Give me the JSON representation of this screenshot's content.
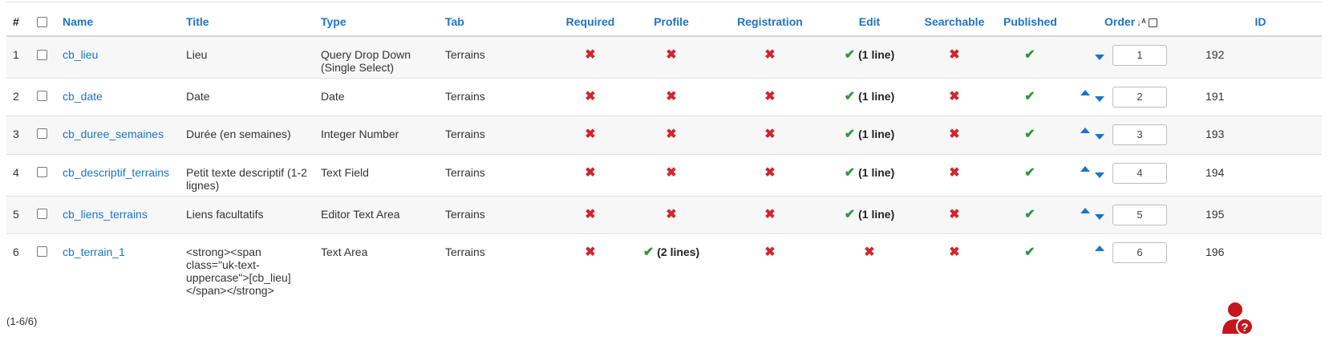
{
  "columns": {
    "num": "#",
    "name": "Name",
    "title": "Title",
    "type": "Type",
    "tab": "Tab",
    "required": "Required",
    "profile": "Profile",
    "registration": "Registration",
    "edit": "Edit",
    "searchable": "Searchable",
    "published": "Published",
    "order": "Order",
    "id": "ID"
  },
  "rows": [
    {
      "num": "1",
      "name": "cb_lieu",
      "title": "Lieu",
      "type": "Query Drop Down (Single Select)",
      "tab": "Terrains",
      "required": "no",
      "profile": "no",
      "profile_note": "",
      "registration": "no",
      "edit": "yes",
      "edit_note": "(1 line)",
      "searchable": "no",
      "published": "yes",
      "order": "1",
      "id": "192"
    },
    {
      "num": "2",
      "name": "cb_date",
      "title": "Date",
      "type": "Date",
      "tab": "Terrains",
      "required": "no",
      "profile": "no",
      "profile_note": "",
      "registration": "no",
      "edit": "yes",
      "edit_note": "(1 line)",
      "searchable": "no",
      "published": "yes",
      "order": "2",
      "id": "191"
    },
    {
      "num": "3",
      "name": "cb_duree_semaines",
      "title": "Durée (en semaines)",
      "type": "Integer Number",
      "tab": "Terrains",
      "required": "no",
      "profile": "no",
      "profile_note": "",
      "registration": "no",
      "edit": "yes",
      "edit_note": "(1 line)",
      "searchable": "no",
      "published": "yes",
      "order": "3",
      "id": "193"
    },
    {
      "num": "4",
      "name": "cb_descriptif_terrains",
      "title": "Petit texte descriptif (1-2 lignes)",
      "type": "Text Field",
      "tab": "Terrains",
      "required": "no",
      "profile": "no",
      "profile_note": "",
      "registration": "no",
      "edit": "yes",
      "edit_note": "(1 line)",
      "searchable": "no",
      "published": "yes",
      "order": "4",
      "id": "194"
    },
    {
      "num": "5",
      "name": "cb_liens_terrains",
      "title": "Liens facultatifs",
      "type": "Editor Text Area",
      "tab": "Terrains",
      "required": "no",
      "profile": "no",
      "profile_note": "",
      "registration": "no",
      "edit": "yes",
      "edit_note": "(1 line)",
      "searchable": "no",
      "published": "yes",
      "order": "5",
      "id": "195"
    },
    {
      "num": "6",
      "name": "cb_terrain_1",
      "title": "<strong><span class=\"uk-text-uppercase\">[cb_lieu]</span></strong>",
      "type": "Text Area",
      "tab": "Terrains",
      "required": "no",
      "profile": "yes",
      "profile_note": "(2 lines)",
      "registration": "no",
      "edit": "no",
      "edit_note": "",
      "searchable": "no",
      "published": "yes",
      "order": "6",
      "id": "196"
    }
  ],
  "pagination": "(1-6/6)",
  "icons": {
    "yes": "check-icon",
    "no": "cross-icon",
    "accent": "#1b74c5",
    "yes_color": "#2a9a3c",
    "no_color": "#d0262d",
    "help_color": "#c4161c"
  }
}
